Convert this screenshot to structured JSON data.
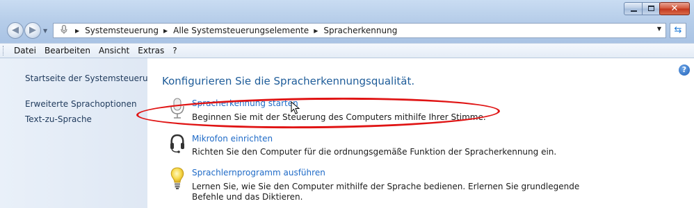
{
  "window": {
    "controls": {
      "minimize": "minimize",
      "maximize": "maximize",
      "close": "✕"
    }
  },
  "address": {
    "icon": "microphone-icon",
    "crumbs": [
      "Systemsteuerung",
      "Alle Systemsteuerungselemente",
      "Spracherkennung"
    ]
  },
  "menu": [
    "Datei",
    "Bearbeiten",
    "Ansicht",
    "Extras",
    "?"
  ],
  "sidebar": {
    "items": [
      {
        "label": "Startseite der Systemsteuerung"
      },
      {
        "label": "Erweiterte Sprachoptionen"
      },
      {
        "label": "Text-zu-Sprache"
      }
    ]
  },
  "main": {
    "heading": "Konfigurieren Sie die Spracherkennungsqualität.",
    "tasks": [
      {
        "icon": "microphone-icon",
        "link": "Spracherkennung starten",
        "description": "Beginnen Sie mit der Steuerung des Computers mithilfe Ihrer Stimme."
      },
      {
        "icon": "headset-icon",
        "link": "Mikrofon einrichten",
        "description": "Richten Sie den Computer für die ordnungsgemäße Funktion der Spracherkennung ein."
      },
      {
        "icon": "lightbulb-icon",
        "link": "Sprachlernprogramm ausführen",
        "description": "Lernen Sie, wie Sie den Computer mithilfe der Sprache bedienen. Erlernen Sie grundlegende Befehle und das Diktieren."
      }
    ]
  },
  "colors": {
    "link": "#1e6ac7",
    "heading": "#1e5c99",
    "annotation": "#e01414"
  }
}
